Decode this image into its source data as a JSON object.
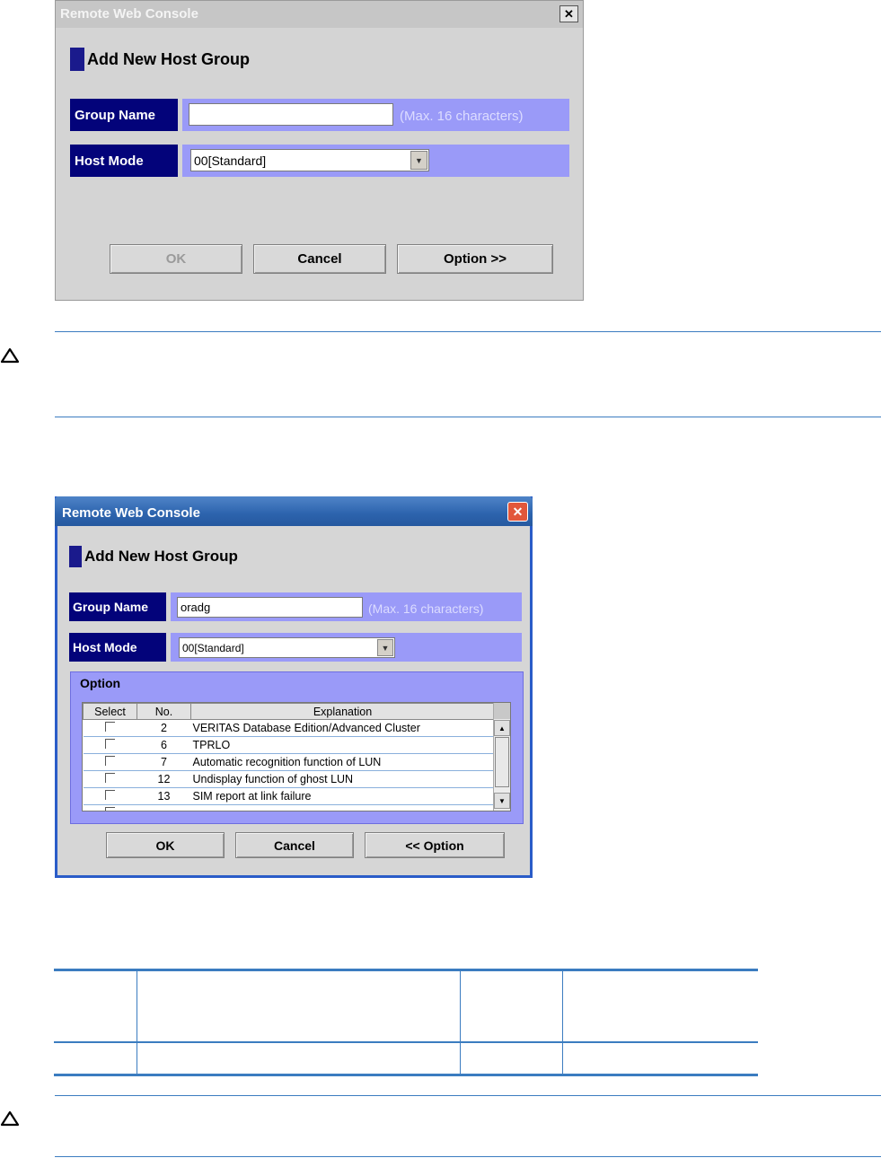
{
  "dialog1": {
    "title": "Remote Web Console",
    "close": "✕",
    "heading": "Add New Host Group",
    "group_name_label": "Group Name",
    "group_name_value": "",
    "group_name_hint": "(Max. 16 characters)",
    "host_mode_label": "Host Mode",
    "host_mode_value": "00[Standard]",
    "ok": "OK",
    "cancel": "Cancel",
    "option": "Option >>"
  },
  "dialog2": {
    "title": "Remote Web Console",
    "close": "✕",
    "heading": "Add New Host Group",
    "group_name_label": "Group Name",
    "group_name_value": "oradg",
    "group_name_hint": "(Max. 16 characters)",
    "host_mode_label": "Host Mode",
    "host_mode_value": "00[Standard]",
    "option_group_label": "Option",
    "table": {
      "headers": [
        "Select",
        "No.",
        "Explanation"
      ],
      "rows": [
        {
          "no": "2",
          "explanation": "VERITAS Database Edition/Advanced Cluster"
        },
        {
          "no": "6",
          "explanation": "TPRLO"
        },
        {
          "no": "7",
          "explanation": "Automatic recognition function of LUN"
        },
        {
          "no": "12",
          "explanation": "Undisplay function of ghost LUN"
        },
        {
          "no": "13",
          "explanation": "SIM report at link failure"
        }
      ]
    },
    "ok": "OK",
    "cancel": "Cancel",
    "option": "<< Option"
  },
  "colors": {
    "label_bg": "#03037a",
    "band_bg": "#9a9af8",
    "rule": "#3b7cc0",
    "title_active": "#3a6ea5"
  }
}
